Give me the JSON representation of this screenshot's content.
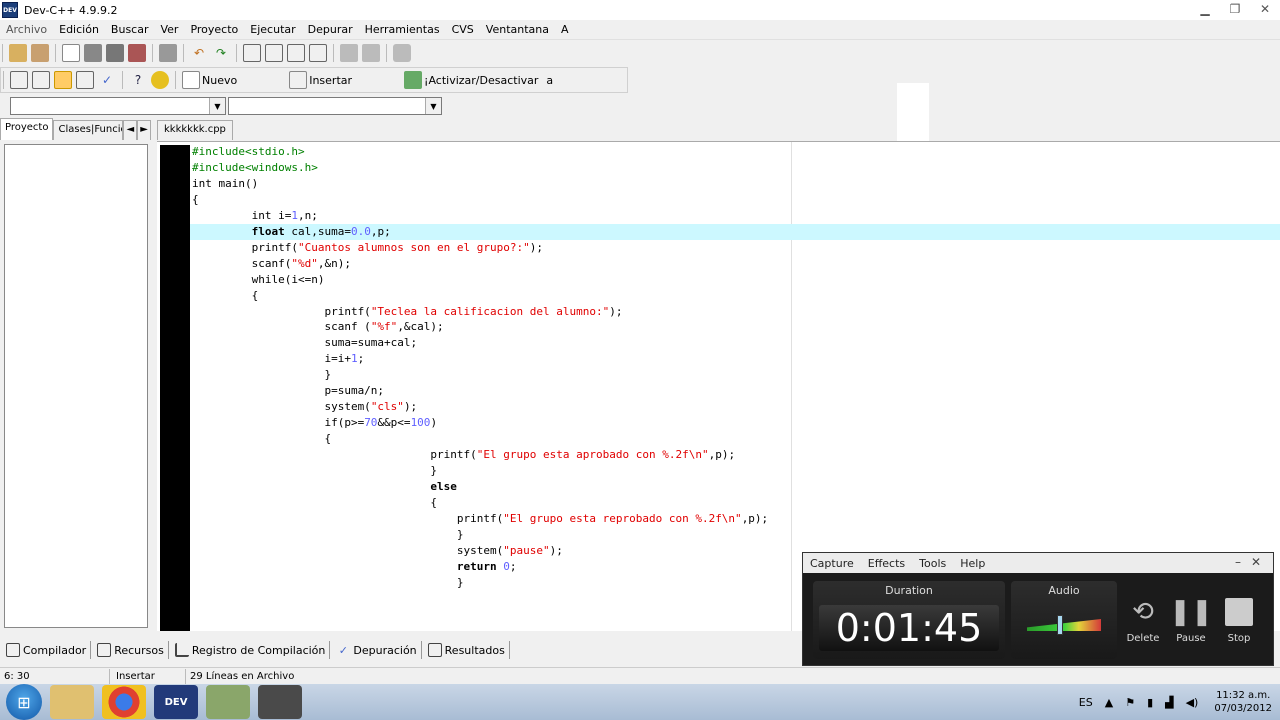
{
  "window": {
    "app_icon_text": "DEV",
    "title": "Dev-C++ 4.9.9.2",
    "min_glyph": "▁",
    "restore_glyph": "❐",
    "close_glyph": "✕"
  },
  "menu": [
    "Archivo",
    "Edición",
    "Buscar",
    "Ver",
    "Proyecto",
    "Ejecutar",
    "Depurar",
    "Herramientas",
    "CVS",
    "Ventantana",
    "A"
  ],
  "toolbar2": {
    "nuevo": "Nuevo",
    "insertar": "Insertar",
    "activar": "¡Activizar/Desactivar",
    "extra": "a"
  },
  "left_panel": {
    "tab_proyecto": "Proyecto",
    "tab_clases": "Clases|Funcio",
    "nav_left": "◄",
    "nav_right": "►"
  },
  "editor": {
    "tab_label": "kkkkkkk.cpp"
  },
  "bottom_tabs": {
    "compilador": "Compilador",
    "recursos": "Recursos",
    "registro": "Registro de Compilación",
    "depuracion": "Depuración",
    "resultados": "Resultados"
  },
  "status": {
    "position": "6: 30",
    "mode": "Insertar",
    "lines": "29 Líneas en Archivo"
  },
  "taskbar": {
    "lang": "ES",
    "time": "11:32 a.m.",
    "date": "07/03/2012",
    "dev_label": "DEV"
  },
  "capture": {
    "menu": [
      "Capture",
      "Effects",
      "Tools",
      "Help"
    ],
    "duration_label": "Duration",
    "duration_value": "0:01:45",
    "audio_label": "Audio",
    "audio_level": 0.45,
    "delete_label": "Delete",
    "pause_label": "Pause",
    "stop_label": "Stop",
    "min_glyph": "–",
    "close_glyph": "✕"
  },
  "icons": {
    "undo": "↶",
    "redo": "↷",
    "help": "?",
    "check": "✓",
    "dropdown": "▼"
  }
}
